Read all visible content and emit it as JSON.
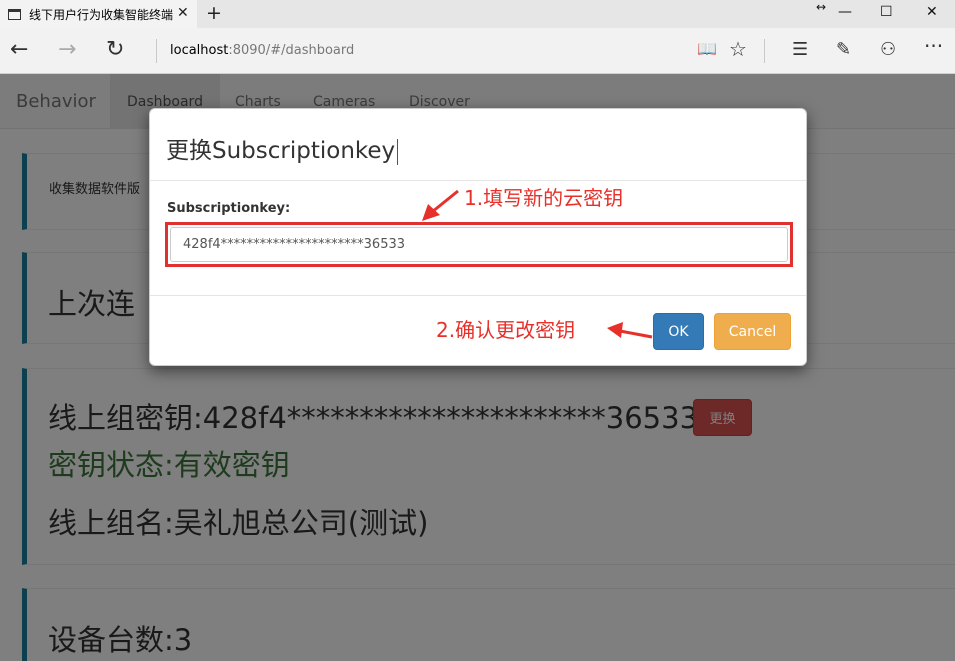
{
  "browser": {
    "tab_title": "线下用户行为收集智能终端",
    "tab_close": "✕",
    "new_tab": "+",
    "window_controls": {
      "resize": "↔",
      "minimize": "—",
      "maximize": "☐",
      "close": "✕"
    },
    "url_host": "localhost",
    "url_rest": ":8090/#/dashboard",
    "icons": [
      "back-icon",
      "forward-icon",
      "refresh-icon",
      "reading-view-icon",
      "favorites-star-icon",
      "hub-icon",
      "web-note-icon",
      "share-icon",
      "more-icon"
    ],
    "glyphs": {
      "back": "←",
      "forward": "→",
      "refresh": "↻",
      "reading": "📖",
      "star": "☆",
      "hub": "☰",
      "note": "✎",
      "share": "⚇",
      "more": "···"
    }
  },
  "app": {
    "brand": "Behavior",
    "nav": [
      "Dashboard",
      "Charts",
      "Cameras",
      "Discover"
    ],
    "active_nav": "Dashboard"
  },
  "cards": {
    "software_version": "收集数据软件版",
    "last_connection": "上次连",
    "online_group_key": "线上组密钥:428f4**********************36533",
    "change_button": "更换",
    "key_status": "密钥状态:有效密钥",
    "online_group_name": "线上组名:吴礼旭总公司(测试)",
    "device_count": "设备台数:3"
  },
  "modal": {
    "title": "更换Subscriptionkey",
    "field_label": "Subscriptionkey:",
    "field_value": "428f4**********************36533",
    "ok_label": "OK",
    "cancel_label": "Cancel"
  },
  "annotations": {
    "step1": "1.填写新的云密钥",
    "step2": "2.确认更改密钥",
    "color": "#e8302a"
  },
  "colors": {
    "primary": "#337ab7",
    "warning": "#f0ad4e",
    "danger": "#d9534f",
    "success_text": "#3c763d",
    "card_accent": "#1b809e"
  }
}
